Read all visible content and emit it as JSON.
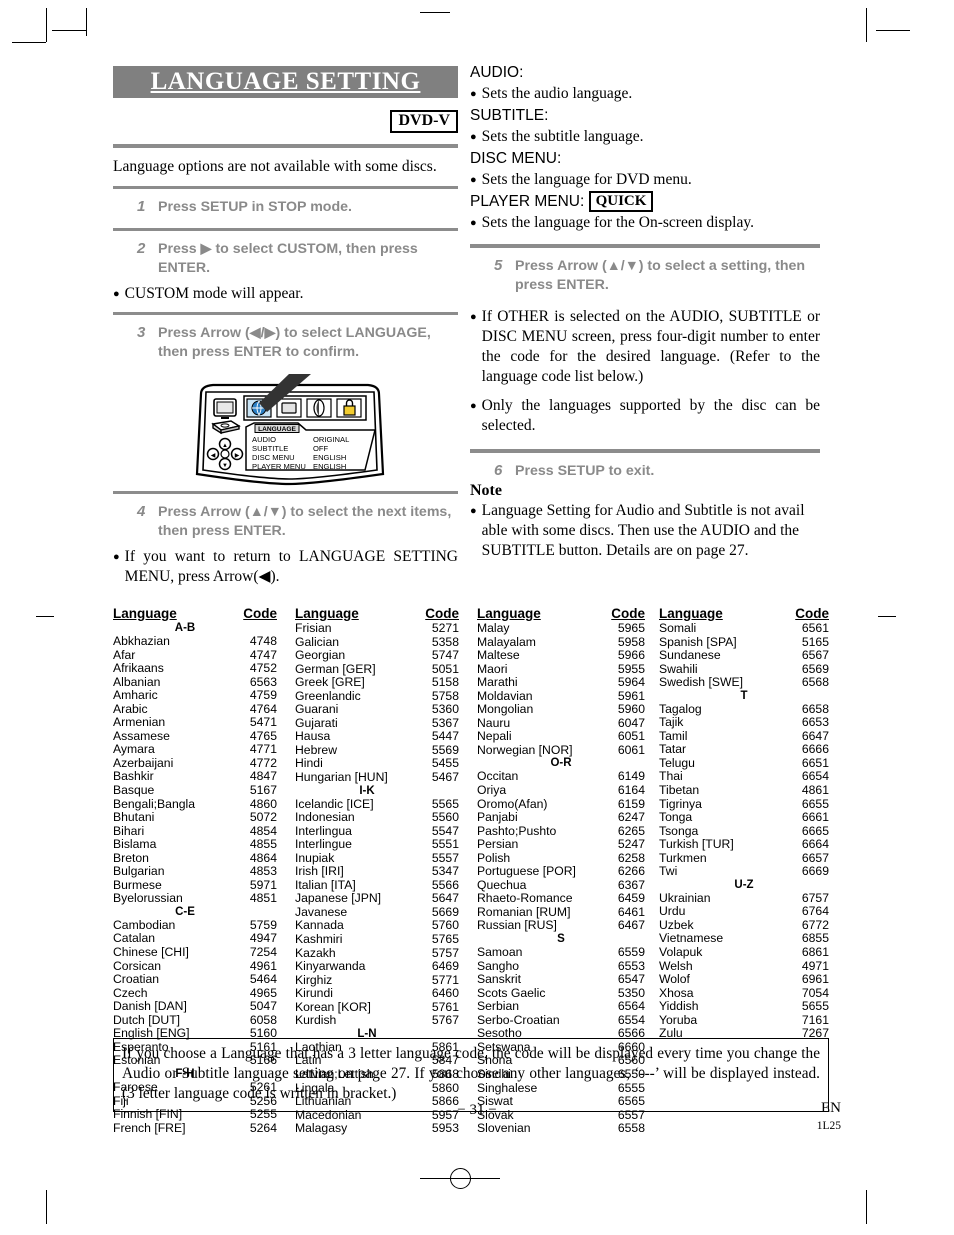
{
  "header": {
    "title": "LANGUAGE SETTING",
    "disc_badge": "DVD-V",
    "intro": "Language options are not available with some discs."
  },
  "left_steps": [
    {
      "num": "1",
      "text": "Press SETUP in STOP mode."
    },
    {
      "num": "2",
      "text": "Press ▶ to select CUSTOM, then press ENTER."
    },
    {
      "num": "3",
      "text": "Press Arrow (◀/▶) to select LANGUAGE, then press ENTER to confirm."
    },
    {
      "num": "4",
      "text": "Press Arrow (▲/▼) to select the next items, then press ENTER."
    }
  ],
  "left_bullets": {
    "after_step2": "CUSTOM mode will appear.",
    "after_step4": "If you want to return to LANGUAGE SETTING MENU, press Arrow(◀)."
  },
  "diagram": {
    "tabs": [
      "language-globe-tab",
      "display-screen-tab",
      "audio-lens-tab",
      "parental-lock-tab"
    ],
    "side_icons": [
      "tv-icon",
      "disc-icon",
      "dpad-icon"
    ],
    "panel_title": "LANGUAGE",
    "rows": [
      {
        "label": "AUDIO",
        "value": "ORIGINAL"
      },
      {
        "label": "SUBTITLE",
        "value": "OFF"
      },
      {
        "label": "DISC MENU",
        "value": "ENGLISH"
      },
      {
        "label": "PLAYER MENU",
        "value": "ENGLISH"
      }
    ]
  },
  "right_settings": [
    {
      "name": "AUDIO:",
      "desc": "Sets the audio language."
    },
    {
      "name": "SUBTITLE:",
      "desc": "Sets the subtitle language."
    },
    {
      "name": "DISC MENU:",
      "desc": "Sets the language for DVD menu."
    },
    {
      "name": "PLAYER MENU:",
      "badge": "QUICK",
      "desc": "Sets the language for the On-screen display."
    }
  ],
  "right_steps": [
    {
      "num": "5",
      "text": "Press Arrow (▲/▼) to select a setting, then press ENTER."
    },
    {
      "num": "6",
      "text": "Press SETUP to exit."
    }
  ],
  "right_bullets": [
    "If OTHER is selected on the AUDIO, SUBTITLE or DISC MENU screen, press four-digit number to enter the code for the desired language. (Refer to the language code list below.)",
    "Only the languages supported by the disc can be selected."
  ],
  "note": {
    "heading": "Note",
    "text": "Language Setting for Audio and Subtitle is not avail able with some discs. Then use the AUDIO and the SUBTITLE button. Details are on page 27."
  },
  "table": {
    "header_language": "Language",
    "header_code": "Code",
    "columns": [
      {
        "entries": [
          {
            "group": "A-B"
          },
          {
            "name": "Abkhazian",
            "code": "4748"
          },
          {
            "name": "Afar",
            "code": "4747"
          },
          {
            "name": "Afrikaans",
            "code": "4752"
          },
          {
            "name": "Albanian",
            "code": "6563"
          },
          {
            "name": "Amharic",
            "code": "4759"
          },
          {
            "name": "Arabic",
            "code": "4764"
          },
          {
            "name": "Armenian",
            "code": "5471"
          },
          {
            "name": "Assamese",
            "code": "4765"
          },
          {
            "name": "Aymara",
            "code": "4771"
          },
          {
            "name": "Azerbaijani",
            "code": "4772"
          },
          {
            "name": "Bashkir",
            "code": "4847"
          },
          {
            "name": "Basque",
            "code": "5167"
          },
          {
            "name": "Bengali;Bangla",
            "code": "4860"
          },
          {
            "name": "Bhutani",
            "code": "5072"
          },
          {
            "name": "Bihari",
            "code": "4854"
          },
          {
            "name": "Bislama",
            "code": "4855"
          },
          {
            "name": "Breton",
            "code": "4864"
          },
          {
            "name": "Bulgarian",
            "code": "4853"
          },
          {
            "name": "Burmese",
            "code": "5971"
          },
          {
            "name": "Byelorussian",
            "code": "4851"
          },
          {
            "group": "C-E"
          },
          {
            "name": "Cambodian",
            "code": "5759"
          },
          {
            "name": "Catalan",
            "code": "4947"
          },
          {
            "name": "Chinese [CHI]",
            "code": "7254"
          },
          {
            "name": "Corsican",
            "code": "4961"
          },
          {
            "name": "Croatian",
            "code": "5464"
          },
          {
            "name": "Czech",
            "code": "4965"
          },
          {
            "name": "Danish [DAN]",
            "code": "5047"
          },
          {
            "name": "Dutch [DUT]",
            "code": "6058"
          },
          {
            "name": "English [ENG]",
            "code": "5160"
          },
          {
            "name": "Esperanto",
            "code": "5161"
          },
          {
            "name": "Estonian",
            "code": "5166"
          },
          {
            "group": "F-H"
          },
          {
            "name": "Faroese",
            "code": "5261"
          },
          {
            "name": "Fiji",
            "code": "5256"
          },
          {
            "name": "Finnish [FIN]",
            "code": "5255"
          },
          {
            "name": "French [FRE]",
            "code": "5264"
          }
        ]
      },
      {
        "entries": [
          {
            "name": "Frisian",
            "code": "5271"
          },
          {
            "name": "Galician",
            "code": "5358"
          },
          {
            "name": "Georgian",
            "code": "5747"
          },
          {
            "name": "German [GER]",
            "code": "5051"
          },
          {
            "name": "Greek [GRE]",
            "code": "5158"
          },
          {
            "name": "Greenlandic",
            "code": "5758"
          },
          {
            "name": "Guarani",
            "code": "5360"
          },
          {
            "name": "Gujarati",
            "code": "5367"
          },
          {
            "name": "Hausa",
            "code": "5447"
          },
          {
            "name": "Hebrew",
            "code": "5569"
          },
          {
            "name": "Hindi",
            "code": "5455"
          },
          {
            "name": "Hungarian [HUN]",
            "code": "5467"
          },
          {
            "group": "I-K"
          },
          {
            "name": "Icelandic [ICE]",
            "code": "5565"
          },
          {
            "name": "Indonesian",
            "code": "5560"
          },
          {
            "name": "Interlingua",
            "code": "5547"
          },
          {
            "name": "Interlingue",
            "code": "5551"
          },
          {
            "name": "Inupiak",
            "code": "5557"
          },
          {
            "name": "Irish [IRI]",
            "code": "5347"
          },
          {
            "name": "Italian [ITA]",
            "code": "5566"
          },
          {
            "name": "Japanese [JPN]",
            "code": "5647"
          },
          {
            "name": "Javanese",
            "code": "5669"
          },
          {
            "name": "Kannada",
            "code": "5760"
          },
          {
            "name": "Kashmiri",
            "code": "5765"
          },
          {
            "name": "Kazakh",
            "code": "5757"
          },
          {
            "name": "Kinyarwanda",
            "code": "6469"
          },
          {
            "name": "Kirghiz",
            "code": "5771"
          },
          {
            "name": "Kirundi",
            "code": "6460"
          },
          {
            "name": "Korean [KOR]",
            "code": "5761"
          },
          {
            "name": "Kurdish",
            "code": "5767"
          },
          {
            "group": "L-N"
          },
          {
            "name": "Laothian",
            "code": "5861"
          },
          {
            "name": "Latin",
            "code": "5847"
          },
          {
            "name": "Latvian;Lettish",
            "code": "5868"
          },
          {
            "name": "Lingala",
            "code": "5860"
          },
          {
            "name": "Lithuanian",
            "code": "5866"
          },
          {
            "name": "Macedonian",
            "code": "5957"
          },
          {
            "name": "Malagasy",
            "code": "5953"
          }
        ]
      },
      {
        "entries": [
          {
            "name": "Malay",
            "code": "5965"
          },
          {
            "name": "Malayalam",
            "code": "5958"
          },
          {
            "name": "Maltese",
            "code": "5966"
          },
          {
            "name": "Maori",
            "code": "5955"
          },
          {
            "name": "Marathi",
            "code": "5964"
          },
          {
            "name": "Moldavian",
            "code": "5961"
          },
          {
            "name": "Mongolian",
            "code": "5960"
          },
          {
            "name": "Nauru",
            "code": "6047"
          },
          {
            "name": "Nepali",
            "code": "6051"
          },
          {
            "name": "Norwegian [NOR]",
            "code": "6061"
          },
          {
            "group": "O-R"
          },
          {
            "name": "Occitan",
            "code": "6149"
          },
          {
            "name": "Oriya",
            "code": "6164"
          },
          {
            "name": "Oromo(Afan)",
            "code": "6159"
          },
          {
            "name": "Panjabi",
            "code": "6247"
          },
          {
            "name": "Pashto;Pushto",
            "code": "6265"
          },
          {
            "name": "Persian",
            "code": "5247"
          },
          {
            "name": "Polish",
            "code": "6258"
          },
          {
            "name": "Portuguese [POR]",
            "code": "6266"
          },
          {
            "name": "Quechua",
            "code": "6367"
          },
          {
            "name": "Rhaeto-Romance",
            "code": "6459"
          },
          {
            "name": "Romanian [RUM]",
            "code": "6461"
          },
          {
            "name": "Russian [RUS]",
            "code": "6467"
          },
          {
            "group": "S"
          },
          {
            "name": "Samoan",
            "code": "6559"
          },
          {
            "name": "Sangho",
            "code": "6553"
          },
          {
            "name": "Sanskrit",
            "code": "6547"
          },
          {
            "name": "Scots Gaelic",
            "code": "5350"
          },
          {
            "name": "Serbian",
            "code": "6564"
          },
          {
            "name": "Serbo-Croatian",
            "code": "6554"
          },
          {
            "name": "Sesotho",
            "code": "6566"
          },
          {
            "name": "Setswana",
            "code": "6660"
          },
          {
            "name": "Shona",
            "code": "6560"
          },
          {
            "name": "Sindhi",
            "code": "6550"
          },
          {
            "name": "Singhalese",
            "code": "6555"
          },
          {
            "name": "Siswat",
            "code": "6565"
          },
          {
            "name": "Slovak",
            "code": "6557"
          },
          {
            "name": "Slovenian",
            "code": "6558"
          }
        ]
      },
      {
        "entries": [
          {
            "name": "Somali",
            "code": "6561"
          },
          {
            "name": "Spanish [SPA]",
            "code": "5165"
          },
          {
            "name": "Sundanese",
            "code": "6567"
          },
          {
            "name": "Swahili",
            "code": "6569"
          },
          {
            "name": "Swedish [SWE]",
            "code": "6568"
          },
          {
            "group": "T"
          },
          {
            "name": "Tagalog",
            "code": "6658"
          },
          {
            "name": "Tajik",
            "code": "6653"
          },
          {
            "name": "Tamil",
            "code": "6647"
          },
          {
            "name": "Tatar",
            "code": "6666"
          },
          {
            "name": "Telugu",
            "code": "6651"
          },
          {
            "name": "Thai",
            "code": "6654"
          },
          {
            "name": "Tibetan",
            "code": "4861"
          },
          {
            "name": "Tigrinya",
            "code": "6655"
          },
          {
            "name": "Tonga",
            "code": "6661"
          },
          {
            "name": "Tsonga",
            "code": "6665"
          },
          {
            "name": "Turkish [TUR]",
            "code": "6664"
          },
          {
            "name": "Turkmen",
            "code": "6657"
          },
          {
            "name": "Twi",
            "code": "6669"
          },
          {
            "group": "U-Z"
          },
          {
            "name": "Ukrainian",
            "code": "6757"
          },
          {
            "name": "Urdu",
            "code": "6764"
          },
          {
            "name": "Uzbek",
            "code": "6772"
          },
          {
            "name": "Vietnamese",
            "code": "6855"
          },
          {
            "name": "Volapuk",
            "code": "6861"
          },
          {
            "name": "Welsh",
            "code": "4971"
          },
          {
            "name": "Wolof",
            "code": "6961"
          },
          {
            "name": "Xhosa",
            "code": "7054"
          },
          {
            "name": "Yiddish",
            "code": "5655"
          },
          {
            "name": "Yoruba",
            "code": "7161"
          },
          {
            "name": "Zulu",
            "code": "7267"
          }
        ]
      }
    ]
  },
  "footer_box": "If you choose a Language that has a 3 letter language code, the code will be displayed every time you change the Audio or Subtitle language setting on page 27. If you choose any other languages, ‘---’ will be displayed instead. (3 letter language code is written in bracket.)",
  "footer": {
    "page_number": "− 31 −",
    "lang_mark": "EN",
    "doc_code": "1L25"
  }
}
